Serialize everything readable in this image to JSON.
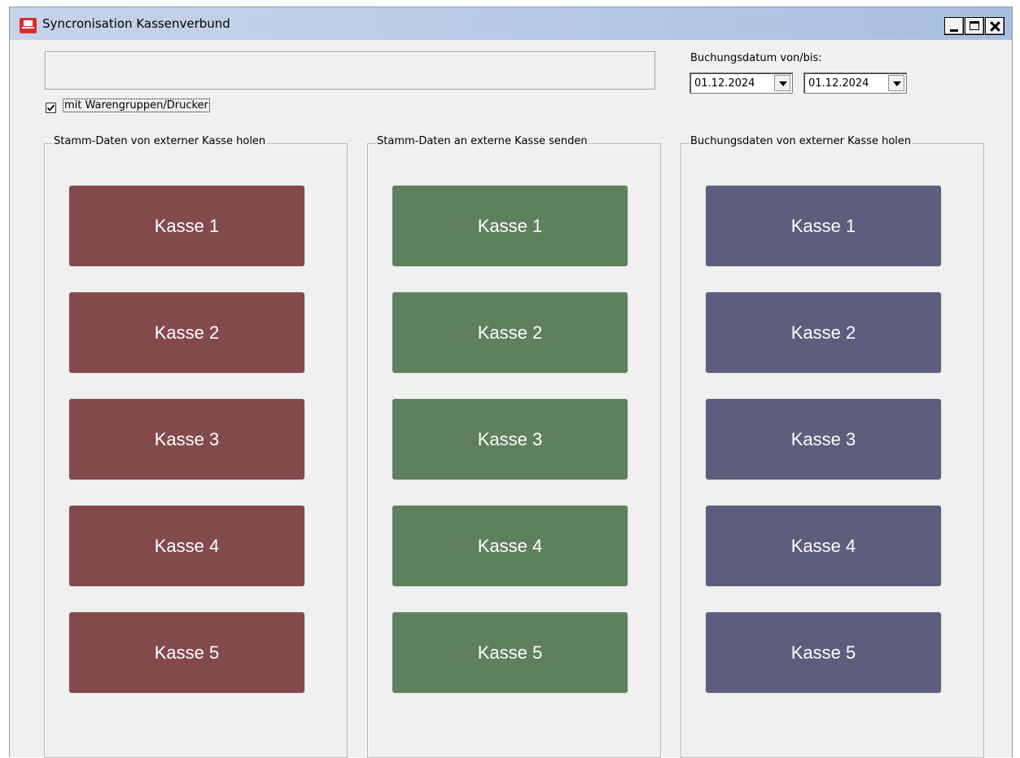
{
  "window": {
    "title": "Syncronisation Kassenverbund"
  },
  "status_text": "",
  "date_range": {
    "label": "Buchungsdatum von/bis:",
    "from": "01.12.2024",
    "to": "01.12.2024"
  },
  "option": {
    "label": "mit Warengruppen/Drucker",
    "checked": true
  },
  "groups": [
    {
      "legend": "Stamm-Daten von externer Kasse holen",
      "color": "#834a4c",
      "buttons": [
        "Kasse 1",
        "Kasse 2",
        "Kasse 3",
        "Kasse 4",
        "Kasse 5"
      ]
    },
    {
      "legend": "Stamm-Daten an externe Kasse senden",
      "color": "#5f805d",
      "buttons": [
        "Kasse 1",
        "Kasse 2",
        "Kasse 3",
        "Kasse 4",
        "Kasse 5"
      ]
    },
    {
      "legend": "Buchungsdaten von externer Kasse holen",
      "color": "#5e5d7e",
      "buttons": [
        "Kasse 1",
        "Kasse 2",
        "Kasse 3",
        "Kasse 4",
        "Kasse 5"
      ]
    }
  ],
  "icons": {
    "app": "cash-register-icon",
    "minimize": "minimize-icon",
    "maximize": "maximize-icon",
    "close": "close-icon",
    "dropdown": "chevron-down-icon",
    "checkbox": "checkmark-icon"
  }
}
